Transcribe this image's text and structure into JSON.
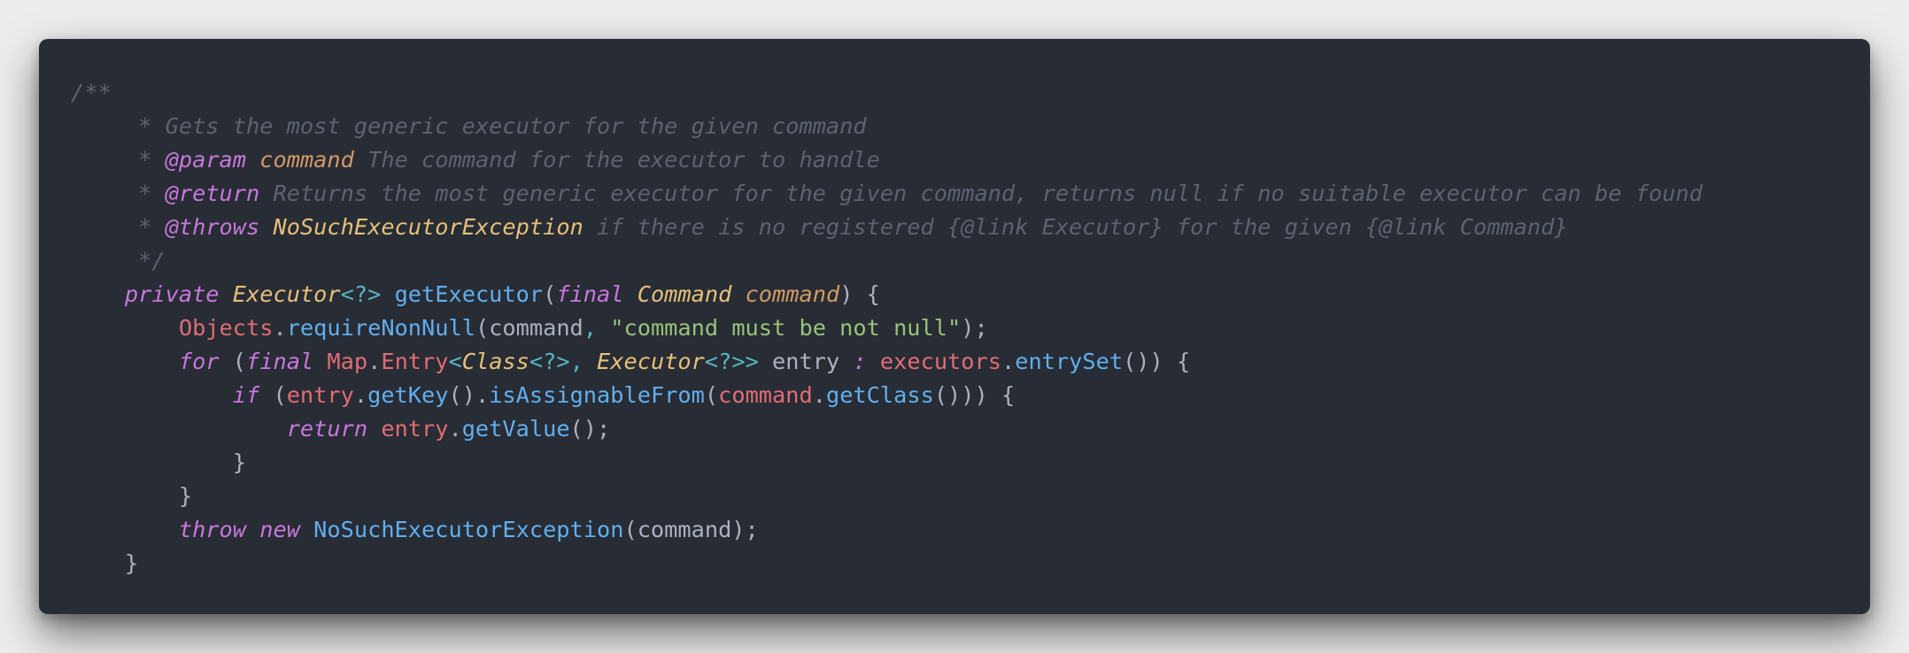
{
  "colors": {
    "background": "#ededed",
    "editor": "#282c34",
    "comment": "#5c6370",
    "keyword": "#c678dd",
    "type": "#e5c07b",
    "param": "#d19a66",
    "function": "#61afef",
    "variable": "#e06c75",
    "string": "#98c379",
    "operator": "#56b6c2",
    "text": "#abb2bf"
  },
  "lines": [
    [
      {
        "t": "/**",
        "c": "comment"
      }
    ],
    [
      {
        "t": "     * Gets the most generic executor for the given command",
        "c": "comment"
      }
    ],
    [
      {
        "t": "     * ",
        "c": "comment"
      },
      {
        "t": "@param",
        "c": "tag"
      },
      {
        "t": " ",
        "c": "comment"
      },
      {
        "t": "command",
        "c": "param"
      },
      {
        "t": " The command for the executor to handle",
        "c": "comment"
      }
    ],
    [
      {
        "t": "     * ",
        "c": "comment"
      },
      {
        "t": "@return",
        "c": "tag"
      },
      {
        "t": " Returns the most generic executor for the given command, returns null if no suitable executor can be found",
        "c": "comment"
      }
    ],
    [
      {
        "t": "     * ",
        "c": "comment"
      },
      {
        "t": "@throws",
        "c": "tag"
      },
      {
        "t": " ",
        "c": "comment"
      },
      {
        "t": "NoSuchExecutorException",
        "c": "throwtype"
      },
      {
        "t": " if there is no registered {@link Executor} for the given {@link Command}",
        "c": "comment"
      }
    ],
    [
      {
        "t": "     */",
        "c": "comment"
      }
    ],
    [
      {
        "t": "    ",
        "c": "plain"
      },
      {
        "t": "private",
        "c": "keyword"
      },
      {
        "t": " ",
        "c": "plain"
      },
      {
        "t": "Executor",
        "c": "type"
      },
      {
        "t": "<?>",
        "c": "op"
      },
      {
        "t": " ",
        "c": "plain"
      },
      {
        "t": "getExecutor",
        "c": "func"
      },
      {
        "t": "(",
        "c": "punc"
      },
      {
        "t": "final",
        "c": "keyword"
      },
      {
        "t": " ",
        "c": "plain"
      },
      {
        "t": "Command",
        "c": "type"
      },
      {
        "t": " ",
        "c": "plain"
      },
      {
        "t": "command",
        "c": "param"
      },
      {
        "t": ") {",
        "c": "punc"
      }
    ],
    [
      {
        "t": "        ",
        "c": "plain"
      },
      {
        "t": "Objects",
        "c": "var"
      },
      {
        "t": ".",
        "c": "punc"
      },
      {
        "t": "requireNonNull",
        "c": "func"
      },
      {
        "t": "(command",
        "c": "plain"
      },
      {
        "t": ", ",
        "c": "op"
      },
      {
        "t": "\"command must be not null\"",
        "c": "string"
      },
      {
        "t": ");",
        "c": "punc"
      }
    ],
    [
      {
        "t": "        ",
        "c": "plain"
      },
      {
        "t": "for",
        "c": "keyword"
      },
      {
        "t": " (",
        "c": "punc"
      },
      {
        "t": "final",
        "c": "keyword"
      },
      {
        "t": " ",
        "c": "plain"
      },
      {
        "t": "Map",
        "c": "var"
      },
      {
        "t": ".",
        "c": "punc"
      },
      {
        "t": "Entry",
        "c": "var"
      },
      {
        "t": "<",
        "c": "op"
      },
      {
        "t": "Class",
        "c": "type"
      },
      {
        "t": "<?>, ",
        "c": "op"
      },
      {
        "t": "Executor",
        "c": "type"
      },
      {
        "t": "<?>>",
        "c": "op"
      },
      {
        "t": " entry ",
        "c": "plain"
      },
      {
        "t": ":",
        "c": "keyword"
      },
      {
        "t": " ",
        "c": "plain"
      },
      {
        "t": "executors",
        "c": "var"
      },
      {
        "t": ".",
        "c": "punc"
      },
      {
        "t": "entrySet",
        "c": "func"
      },
      {
        "t": "()) {",
        "c": "punc"
      }
    ],
    [
      {
        "t": "            ",
        "c": "plain"
      },
      {
        "t": "if",
        "c": "keyword"
      },
      {
        "t": " (",
        "c": "punc"
      },
      {
        "t": "entry",
        "c": "var"
      },
      {
        "t": ".",
        "c": "punc"
      },
      {
        "t": "getKey",
        "c": "func"
      },
      {
        "t": "().",
        "c": "punc"
      },
      {
        "t": "isAssignableFrom",
        "c": "func"
      },
      {
        "t": "(",
        "c": "punc"
      },
      {
        "t": "command",
        "c": "var"
      },
      {
        "t": ".",
        "c": "punc"
      },
      {
        "t": "getClass",
        "c": "func"
      },
      {
        "t": "())) {",
        "c": "punc"
      }
    ],
    [
      {
        "t": "                ",
        "c": "plain"
      },
      {
        "t": "return",
        "c": "keyword"
      },
      {
        "t": " ",
        "c": "plain"
      },
      {
        "t": "entry",
        "c": "var"
      },
      {
        "t": ".",
        "c": "punc"
      },
      {
        "t": "getValue",
        "c": "func"
      },
      {
        "t": "();",
        "c": "punc"
      }
    ],
    [
      {
        "t": "            }",
        "c": "punc"
      }
    ],
    [
      {
        "t": "        }",
        "c": "punc"
      }
    ],
    [
      {
        "t": "        ",
        "c": "plain"
      },
      {
        "t": "throw",
        "c": "keyword"
      },
      {
        "t": " ",
        "c": "plain"
      },
      {
        "t": "new",
        "c": "keyword"
      },
      {
        "t": " ",
        "c": "plain"
      },
      {
        "t": "NoSuchExecutorException",
        "c": "func"
      },
      {
        "t": "(command);",
        "c": "punc"
      }
    ],
    [
      {
        "t": "    }",
        "c": "punc"
      }
    ]
  ]
}
